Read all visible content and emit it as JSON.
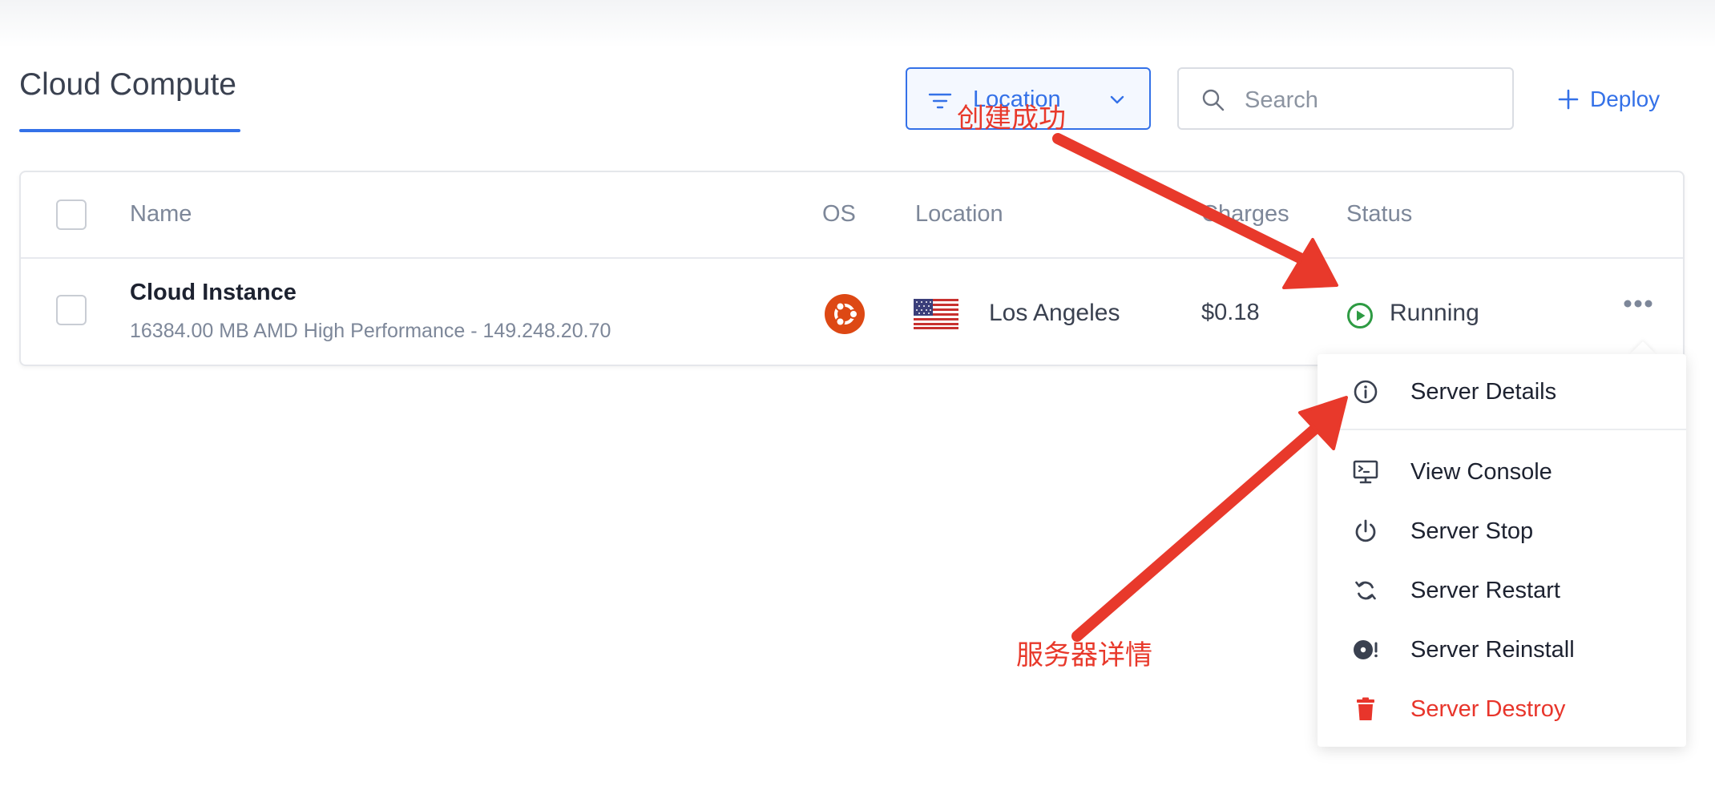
{
  "header": {
    "title": "Cloud Compute",
    "filter_label": "Location",
    "search_placeholder": "Search",
    "deploy_label": "Deploy"
  },
  "table": {
    "columns": [
      "Name",
      "OS",
      "Location",
      "Charges",
      "Status"
    ],
    "rows": [
      {
        "name": "Cloud Instance",
        "subtitle": "16384.00 MB AMD High Performance - 149.248.20.70",
        "os_icon": "ubuntu-icon",
        "flag_icon": "us-flag-icon",
        "location": "Los Angeles",
        "charges": "$0.18",
        "status": "Running"
      }
    ]
  },
  "menu": {
    "items": [
      {
        "label": "Server Details",
        "icon": "info-icon"
      },
      {
        "label": "View Console",
        "icon": "console-icon"
      },
      {
        "label": "Server Stop",
        "icon": "power-icon"
      },
      {
        "label": "Server Restart",
        "icon": "restart-icon"
      },
      {
        "label": "Server Reinstall",
        "icon": "reinstall-icon"
      },
      {
        "label": "Server Destroy",
        "icon": "trash-icon"
      }
    ]
  },
  "annotations": {
    "top": "创建成功",
    "bottom": "服务器详情"
  },
  "colors": {
    "accent": "#3471e8",
    "status_running": "#2e9b43",
    "ubuntu": "#dd4814",
    "danger": "#e8352b",
    "annotation": "#e8392b"
  }
}
